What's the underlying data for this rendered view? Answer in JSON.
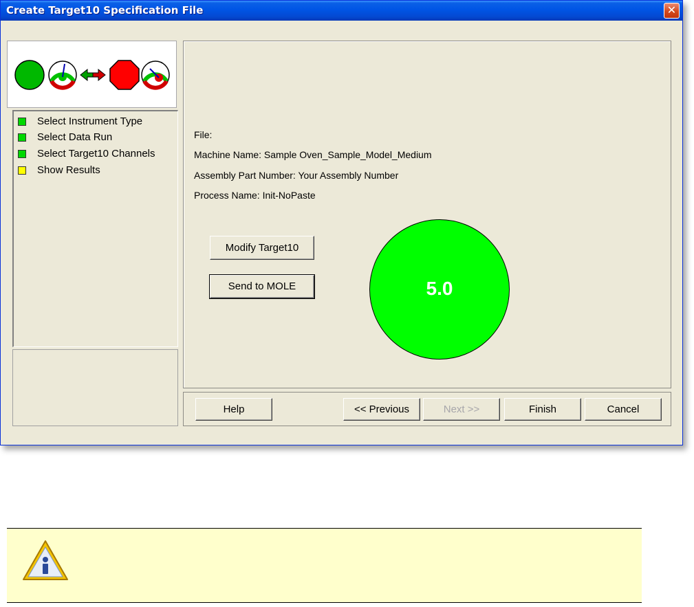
{
  "window": {
    "title": "Create Target10 Specification File",
    "close_label": "✕"
  },
  "logo": {
    "icons": [
      "green-circle-icon",
      "green-gauge-icon",
      "double-arrow-icon",
      "red-stop-octagon-icon",
      "red-gauge-icon"
    ]
  },
  "steps": [
    {
      "label": "Select Instrument Type",
      "status_color": "#00d800"
    },
    {
      "label": "Select Data Run",
      "status_color": "#00d800"
    },
    {
      "label": "Select Target10 Channels",
      "status_color": "#00d800"
    },
    {
      "label": "Show Results",
      "status_color": "#ffff00"
    }
  ],
  "info": {
    "file": "File:",
    "machine_name": "Machine Name: Sample Oven_Sample_Model_Medium",
    "assembly_part_number": "Assembly Part Number: Your Assembly Number",
    "process_name": "Process Name: Init-NoPaste"
  },
  "actions": {
    "modify_label": "Modify Target10",
    "send_label": "Send to MOLE"
  },
  "score": {
    "value": "5.0",
    "color": "#00ff00"
  },
  "nav": {
    "help": "Help",
    "previous": "<< Previous",
    "next": "Next >>",
    "finish": "Finish",
    "cancel": "Cancel"
  },
  "note": {
    "icon": "info-warning-triangle-icon"
  }
}
